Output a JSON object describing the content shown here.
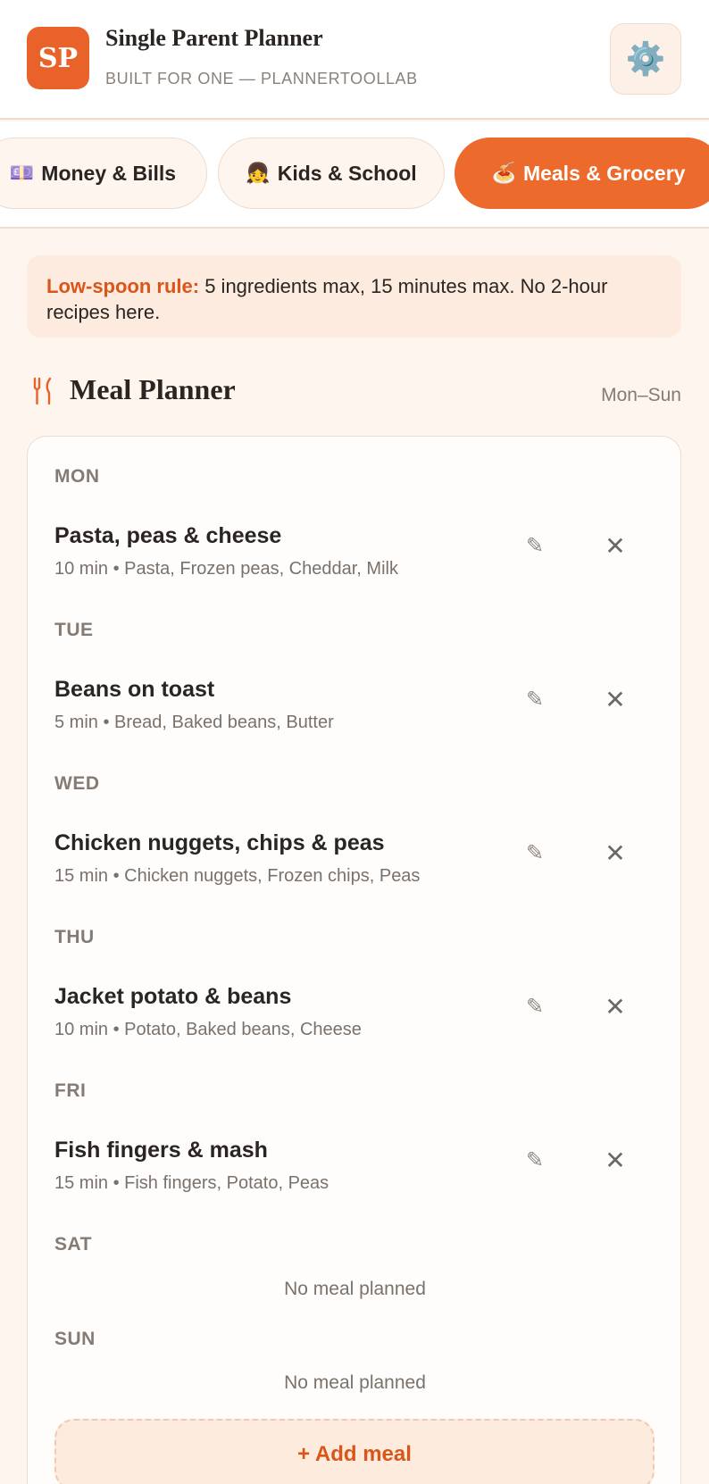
{
  "header": {
    "logo": "SP",
    "title": "Single Parent Planner",
    "subtitle": "BUILT FOR ONE — PLANNERTOOLLAB",
    "settings_icon": "⚙️"
  },
  "tabs": [
    {
      "icon": "💷",
      "label": "Money & Bills"
    },
    {
      "icon": "👧",
      "label": "Kids & School"
    },
    {
      "icon": "🍝",
      "label": "Meals & Grocery"
    }
  ],
  "active_tab": "Meals & Grocery",
  "tip": {
    "label": "Low-spoon rule:",
    "text": " 5 ingredients max, 15 minutes max. No 2-hour recipes here."
  },
  "planner": {
    "title": "Meal Planner",
    "range": "Mon–Sun",
    "days": [
      {
        "day": "MON",
        "meal": "Pasta, peas & cheese",
        "meta": "10 min • Pasta, Frozen peas, Cheddar, Milk"
      },
      {
        "day": "TUE",
        "meal": "Beans on toast",
        "meta": "5 min • Bread, Baked beans, Butter"
      },
      {
        "day": "WED",
        "meal": "Chicken nuggets, chips & peas",
        "meta": "15 min • Chicken nuggets, Frozen chips, Peas"
      },
      {
        "day": "THU",
        "meal": "Jacket potato & beans",
        "meta": "10 min • Potato, Baked beans, Cheese"
      },
      {
        "day": "FRI",
        "meal": "Fish fingers & mash",
        "meta": "15 min • Fish fingers, Potato, Peas"
      },
      {
        "day": "SAT",
        "empty": "No meal planned"
      },
      {
        "day": "SUN",
        "empty": "No meal planned"
      }
    ],
    "edit_icon": "✎",
    "delete_icon": "✕",
    "add_label": "+ Add meal"
  },
  "colors": {
    "accent": "#ec6a2c",
    "background": "#fdf5ee",
    "tip_background": "#fcebde"
  }
}
